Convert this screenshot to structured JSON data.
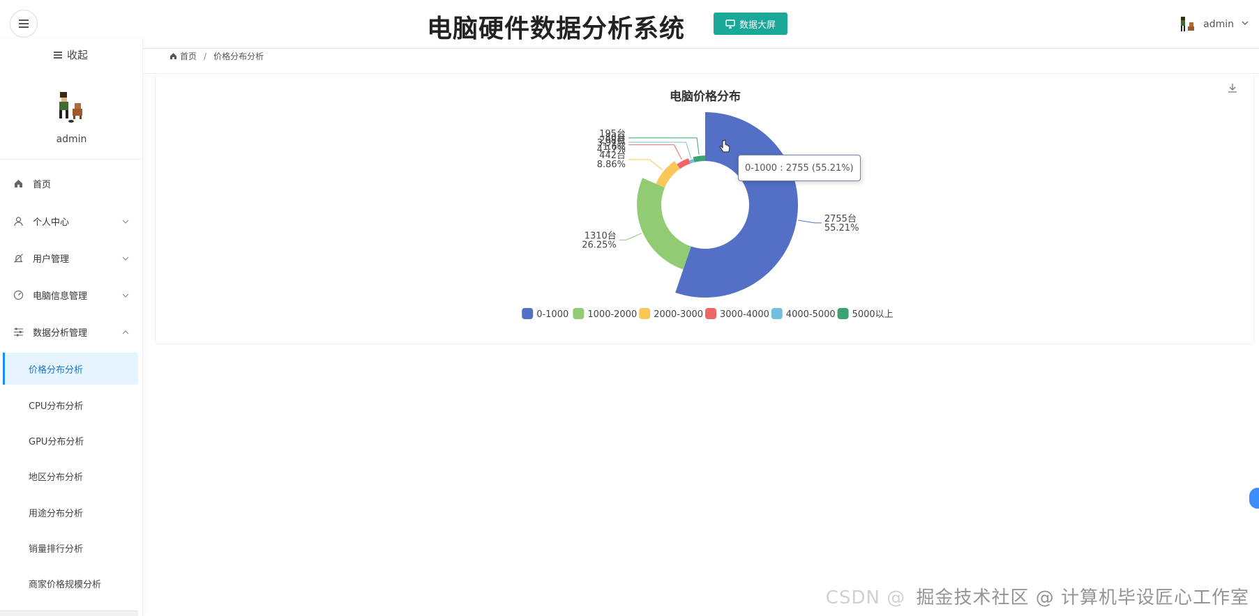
{
  "header": {
    "title": "电脑硬件数据分析系统",
    "screen_button": "数据大屏",
    "username": "admin"
  },
  "sidebar": {
    "collapse_label": "收起",
    "username": "admin",
    "nav": [
      {
        "label": "首页"
      },
      {
        "label": "个人中心"
      },
      {
        "label": "用户管理"
      },
      {
        "label": "电脑信息管理"
      },
      {
        "label": "数据分析管理"
      }
    ],
    "sub": [
      {
        "label": "价格分布分析"
      },
      {
        "label": "CPU分布分析"
      },
      {
        "label": "GPU分布分析"
      },
      {
        "label": "地区分布分析"
      },
      {
        "label": "用途分布分析"
      },
      {
        "label": "销量排行分析"
      },
      {
        "label": "商家价格规模分析"
      }
    ]
  },
  "breadcrumb": {
    "home": "首页",
    "separator": "/",
    "current": "价格分布分析"
  },
  "tooltip": "0-1000 : 2755 (55.21%)",
  "watermark": {
    "main": "掘金技术社区 @ 计算机毕设匠心工作室",
    "back": "CSDN @"
  },
  "colors": {
    "accent": "#1aa898",
    "active_bg": "#e6f4ff",
    "active_text": "#1677c8"
  },
  "chart_data": {
    "type": "pie",
    "variant": "rose",
    "title": "电脑价格分布",
    "legend_position": "bottom",
    "categories": [
      "0-1000",
      "1000-2000",
      "2000-3000",
      "3000-4000",
      "4000-5000",
      "5000以上"
    ],
    "values": [
      2755,
      1310,
      442,
      208,
      80,
      195
    ],
    "labels": [
      [
        "2755台",
        "55.21%"
      ],
      [
        "1310台",
        "26.25%"
      ],
      [
        "442台",
        "8.86%"
      ],
      [
        "208台",
        "4.17%"
      ],
      [
        "80台",
        "1.6%"
      ],
      [
        "195台",
        "3.91%"
      ]
    ],
    "colors": [
      "#5470c6",
      "#91cc75",
      "#fac858",
      "#ee6666",
      "#73c0de",
      "#3ba272"
    ]
  }
}
